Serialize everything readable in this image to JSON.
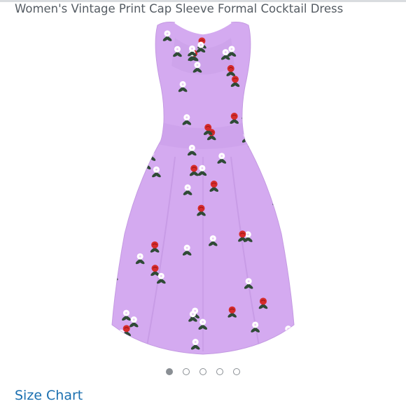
{
  "product": {
    "title": "Women's Vintage Print Cap Sleeve Formal Cocktail Dress",
    "image_icon": "purple-floral-dress",
    "dress_color": "#d4aaf0",
    "print_colors": [
      "#ffffff",
      "#d62b2b",
      "#2f4a36"
    ]
  },
  "carousel": {
    "count": 5,
    "active_index": 0
  },
  "links": {
    "size_chart": "Size Chart"
  }
}
